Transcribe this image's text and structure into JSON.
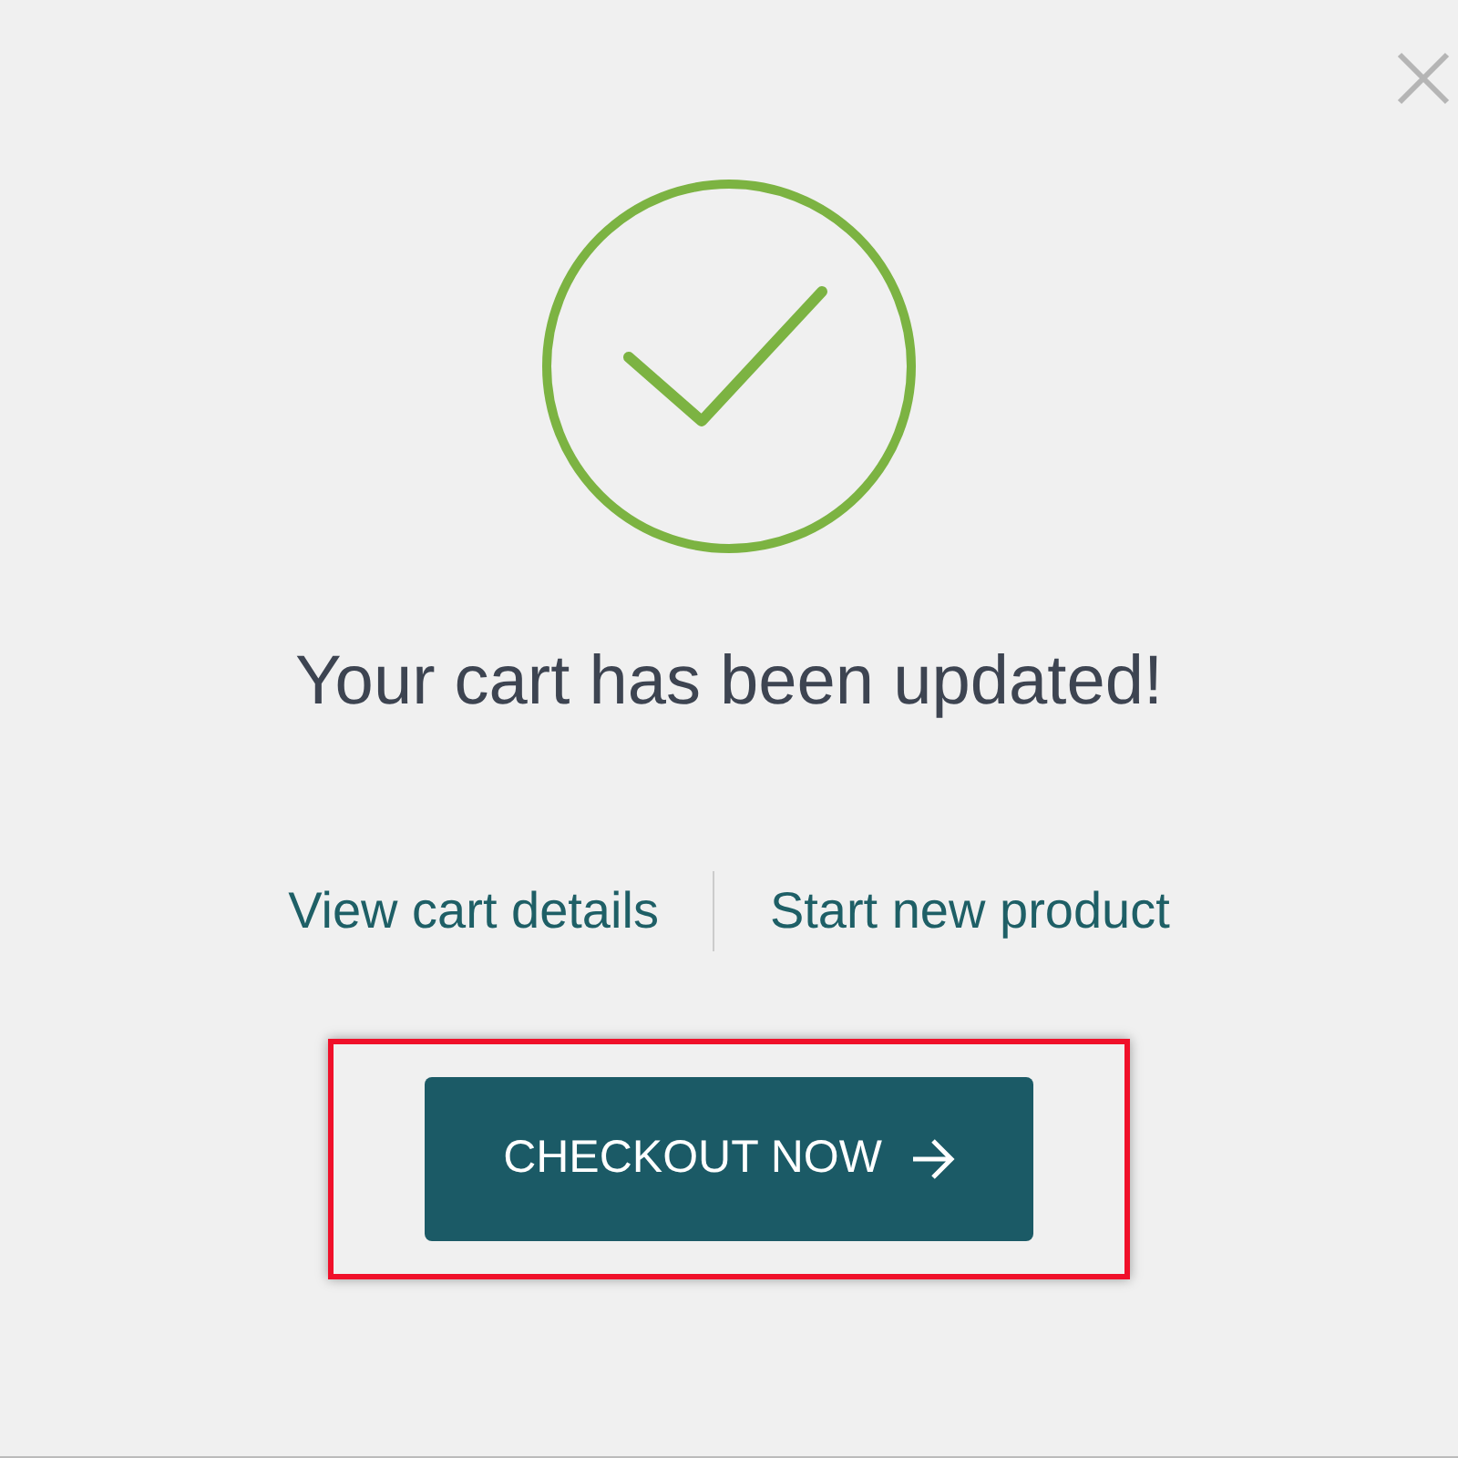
{
  "message": "Your cart has been updated!",
  "links": [
    {
      "label": "View cart details"
    },
    {
      "label": "Start new product"
    }
  ],
  "checkout_button": {
    "label": "CHECKOUT NOW",
    "highlighted": true
  }
}
